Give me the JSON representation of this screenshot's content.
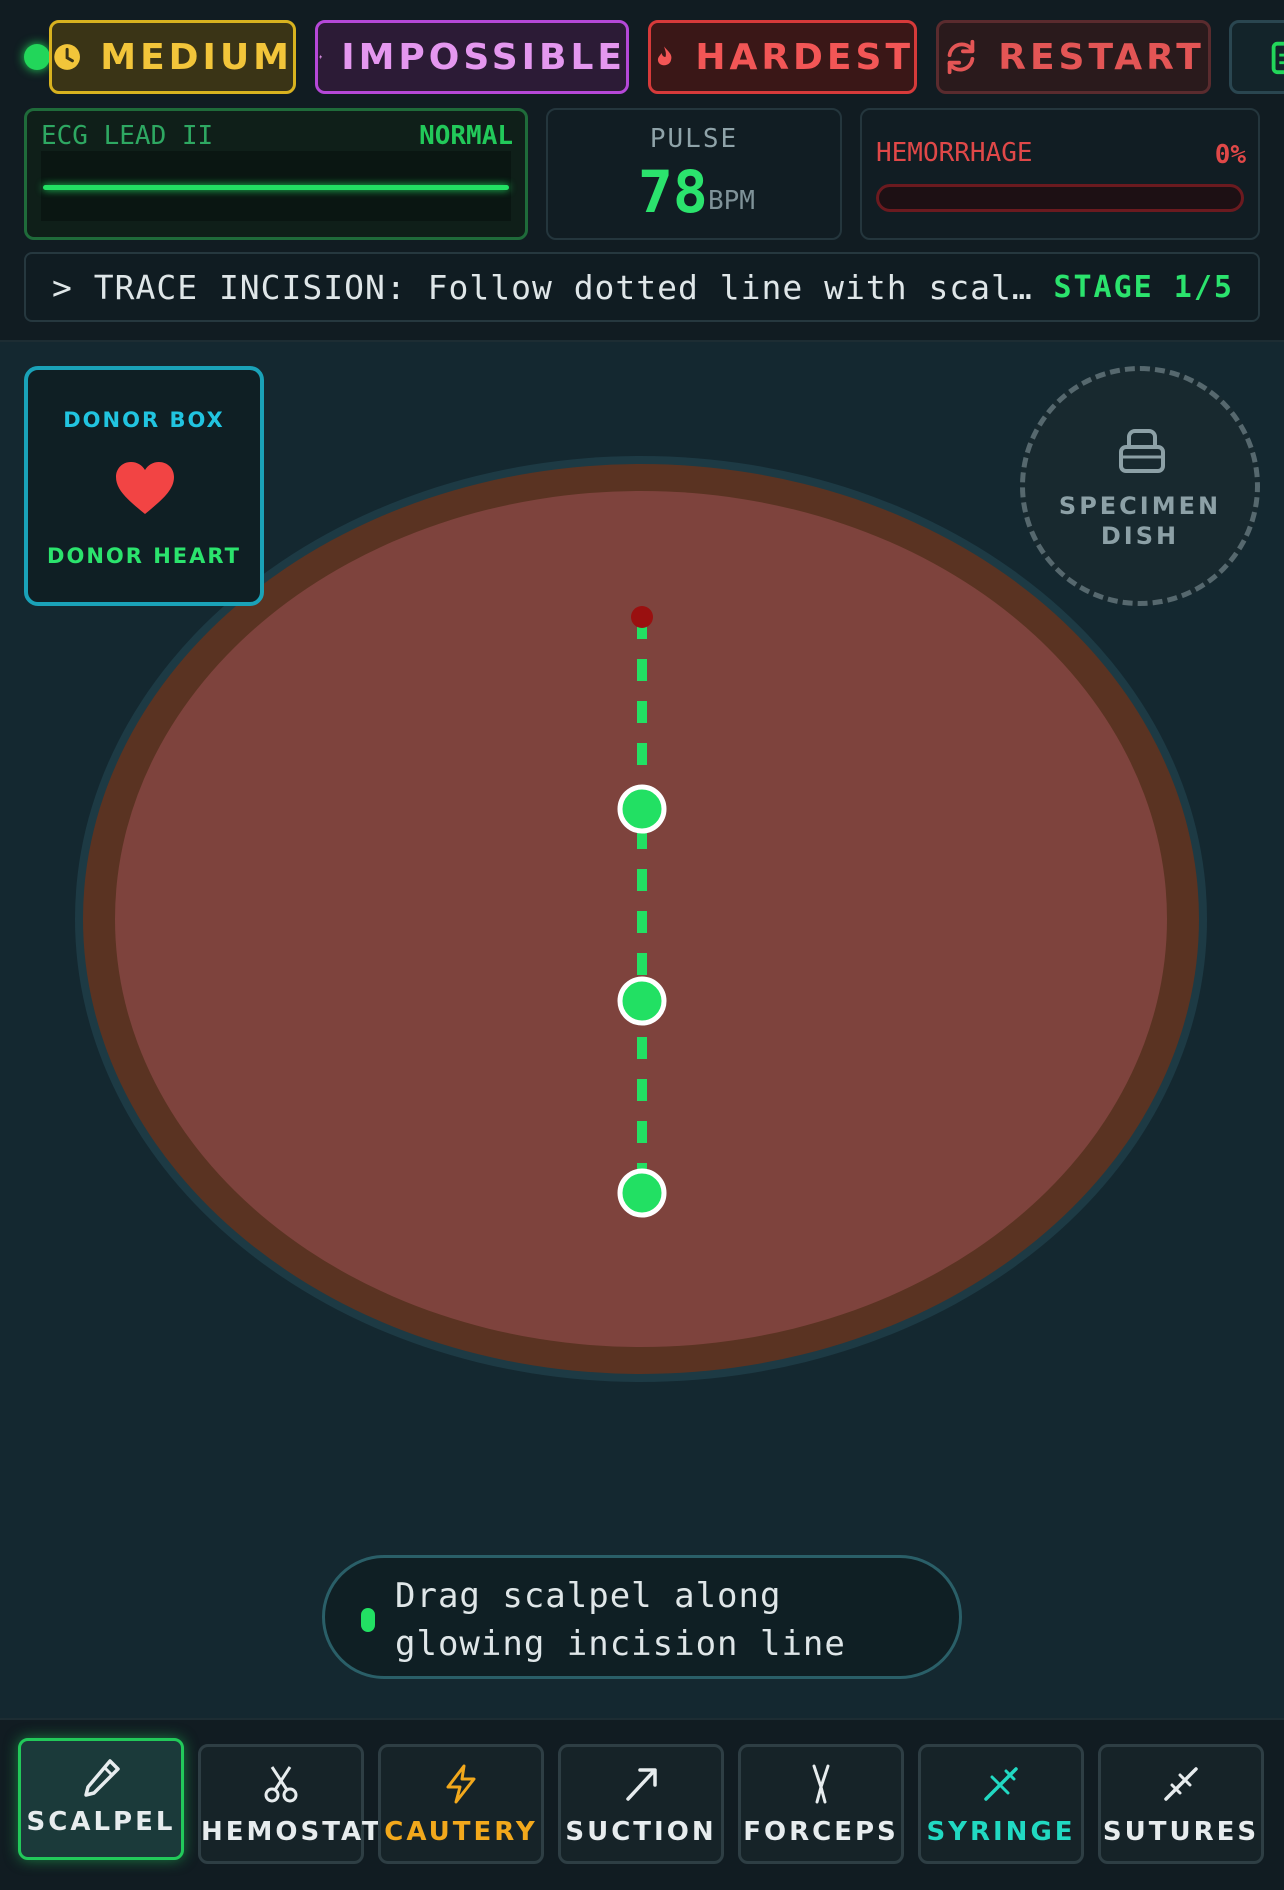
{
  "difficulty": {
    "medium_label": "MEDIUM",
    "impossible_label": "IMPOSSIBLE",
    "hardest_label": "HARDEST",
    "restart_label": "RESTART"
  },
  "ecg": {
    "label": "ECG LEAD II",
    "status": "NORMAL"
  },
  "pulse": {
    "label": "PULSE",
    "value": "78",
    "unit": "BPM"
  },
  "hemorrhage": {
    "label": "HEMORRHAGE",
    "value": "0%",
    "level": 0
  },
  "instruction": {
    "text": "> TRACE INCISION: Follow dotted line with scal…",
    "stage": "STAGE 1/5"
  },
  "donor_box": {
    "title": "DONOR BOX",
    "item_label": "DONOR HEART"
  },
  "specimen_dish": {
    "label_line1": "SPECIMEN",
    "label_line2": "DISH"
  },
  "hint": {
    "line1": "Drag scalpel along",
    "line2": "glowing incision line"
  },
  "tools": [
    {
      "label": "SCALPEL",
      "icon": "scalpel-icon",
      "active": true
    },
    {
      "label": "HEMOSTAT",
      "icon": "scissors-icon",
      "active": false
    },
    {
      "label": "CAUTERY",
      "icon": "lightning-icon",
      "active": false
    },
    {
      "label": "SUCTION",
      "icon": "suction-arrow-icon",
      "active": false
    },
    {
      "label": "FORCEPS",
      "icon": "forceps-icon",
      "active": false
    },
    {
      "label": "SYRINGE",
      "icon": "syringe-icon",
      "active": false
    },
    {
      "label": "SUTURES",
      "icon": "needle-icon",
      "active": false
    }
  ],
  "colors": {
    "accent_green": "#22e063",
    "medium": "#f2c53a",
    "impossible": "#e497ef",
    "hardest": "#f25656",
    "cautery": "#f2a81c",
    "syringe": "#21d9c2",
    "tissue": "#7e433d",
    "skin_border": "#5a3322"
  }
}
